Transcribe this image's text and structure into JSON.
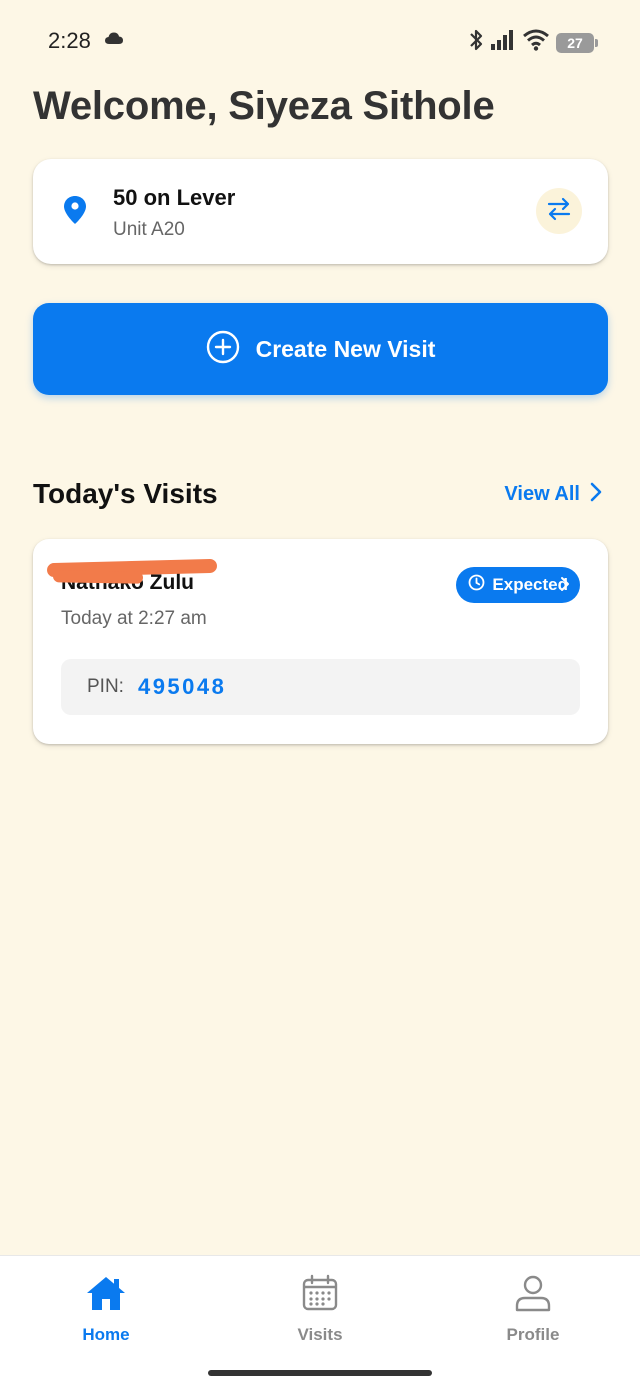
{
  "status_bar": {
    "time": "2:28",
    "battery_level": "27"
  },
  "welcome_title": "Welcome, Siyeza Sithole",
  "location": {
    "name": "50 on Lever",
    "unit": "Unit A20"
  },
  "create_visit": {
    "label": "Create New Visit"
  },
  "todays_visits": {
    "title": "Today's Visits",
    "view_all_label": "View All",
    "visits": [
      {
        "visitor_name": "Nathako Zulu",
        "time": "Today at 2:27 am",
        "status": "Expected",
        "pin_label": "PIN:",
        "pin": "495048"
      }
    ]
  },
  "bottom_nav": {
    "items": [
      {
        "label": "Home",
        "icon": "home-icon",
        "active": true
      },
      {
        "label": "Visits",
        "icon": "calendar-icon",
        "active": false
      },
      {
        "label": "Profile",
        "icon": "person-icon",
        "active": false
      }
    ]
  },
  "colors": {
    "accent": "#0a7aef",
    "background": "#fdf7e6",
    "redaction": "#f27b4a"
  }
}
